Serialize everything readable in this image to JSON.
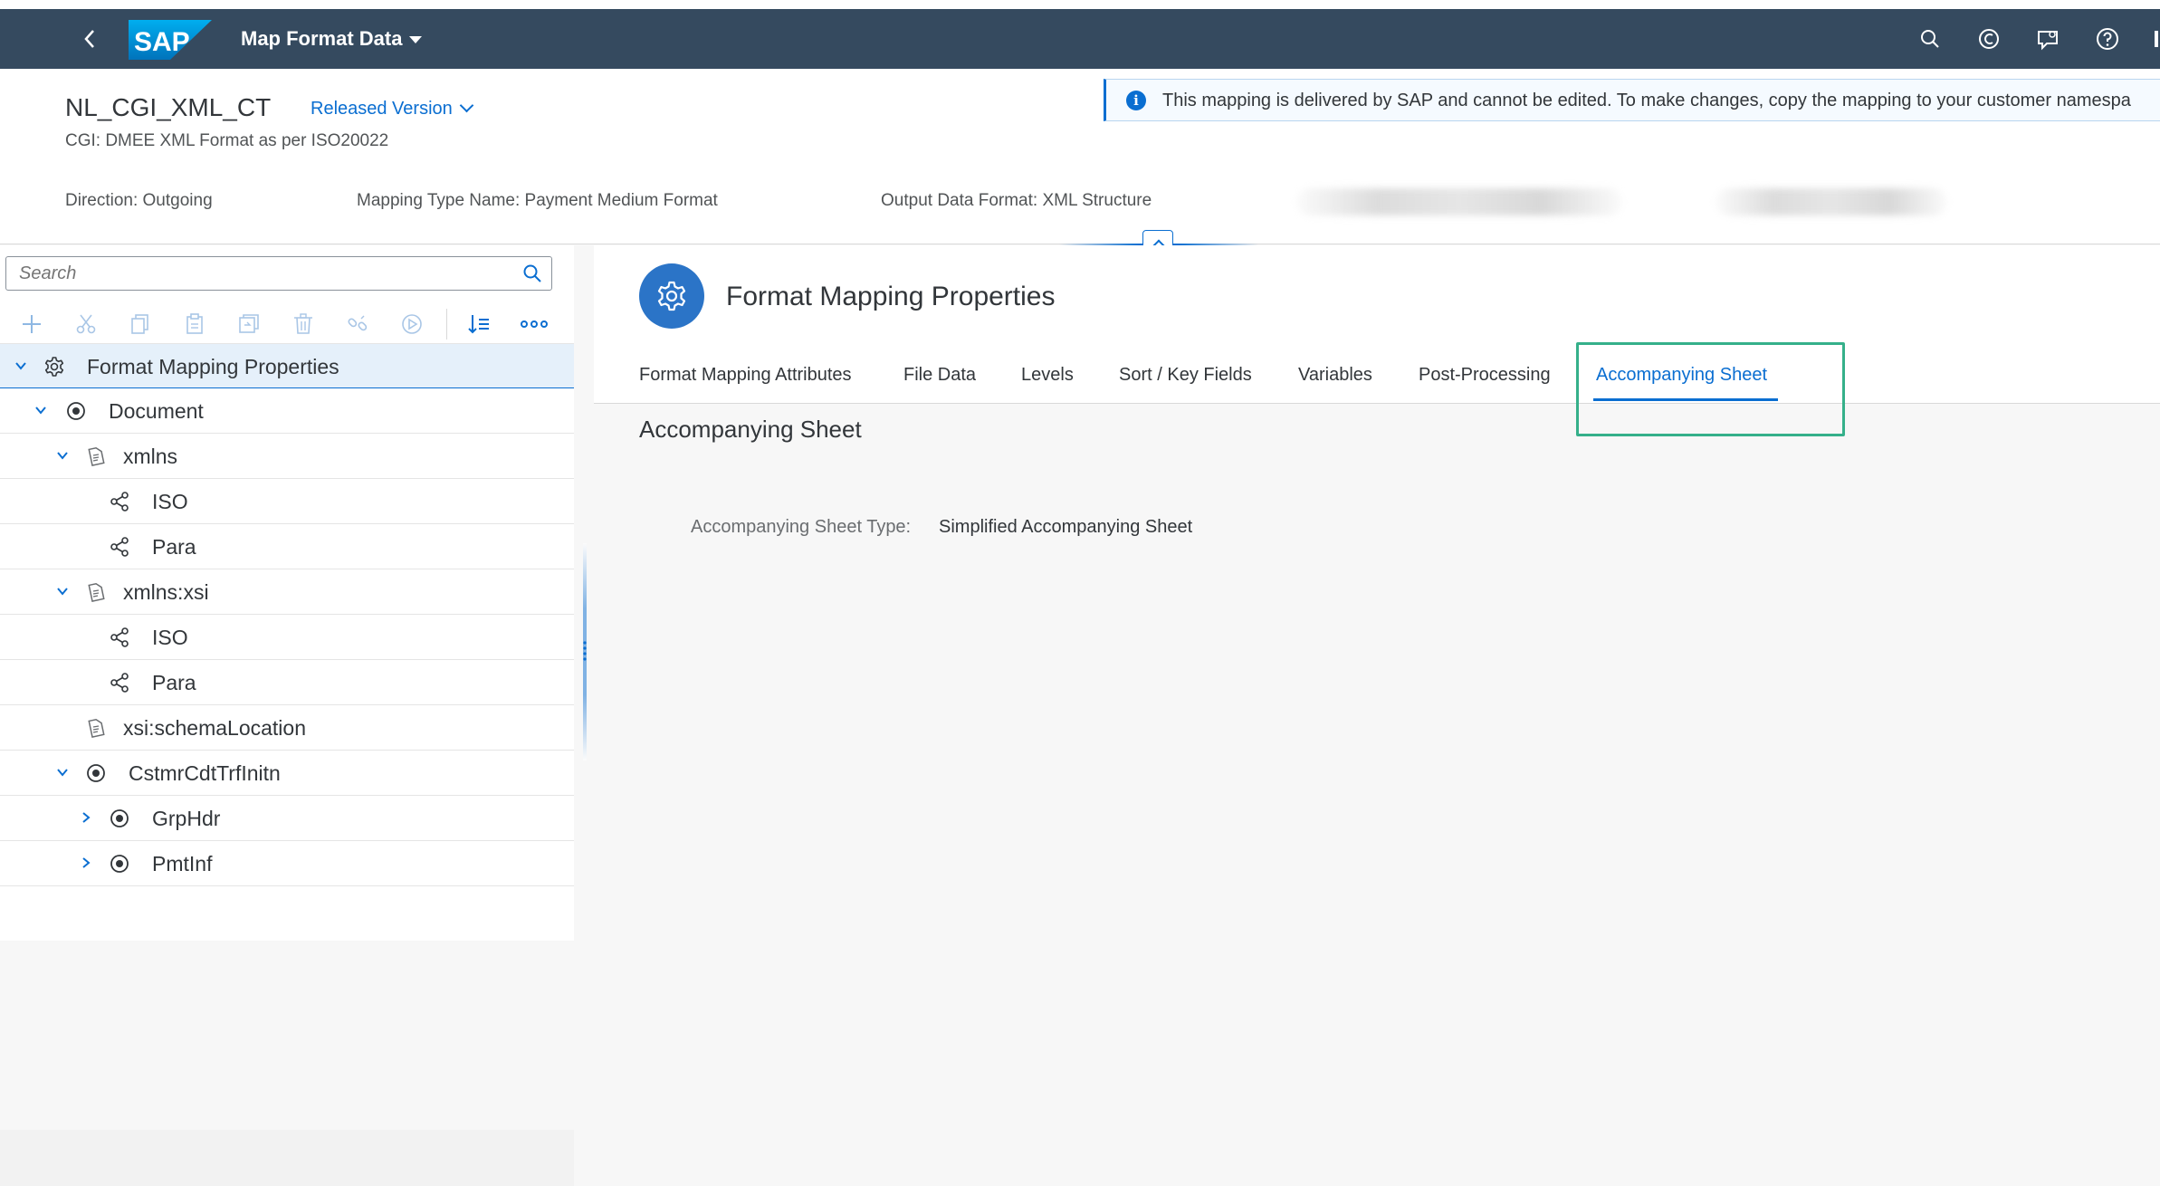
{
  "shell": {
    "app_title": "Map Format Data",
    "logo_text": "SAP"
  },
  "header": {
    "object_title": "NL_CGI_XML_CT",
    "version": "Released Version",
    "subtitle": "CGI: DMEE XML Format as per ISO20022",
    "message": "This mapping is delivered by SAP and cannot be edited. To make changes, copy the mapping to your customer namespa",
    "attributes": [
      "Direction: Outgoing",
      "Mapping Type Name: Payment Medium Format",
      "Output Data Format: XML Structure"
    ]
  },
  "tree": {
    "search_placeholder": "Search",
    "toolbar_icons": [
      "add-icon",
      "cut-icon",
      "copy-icon",
      "paste-icon",
      "duplicate-icon",
      "delete-icon",
      "unlink-icon",
      "run-icon",
      "sort-icon",
      "more-icon"
    ],
    "rows": [
      {
        "label": "Format Mapping Properties",
        "icon": "gear-icon",
        "expander": "down"
      },
      {
        "label": "Document",
        "icon": "radio-node-icon",
        "expander": "down"
      },
      {
        "label": "xmlns",
        "icon": "attribute-icon",
        "expander": "down"
      },
      {
        "label": "ISO",
        "icon": "share-icon",
        "expander": "none"
      },
      {
        "label": "Para",
        "icon": "share-icon",
        "expander": "none"
      },
      {
        "label": "xmlns:xsi",
        "icon": "attribute-icon",
        "expander": "down"
      },
      {
        "label": "ISO",
        "icon": "share-icon",
        "expander": "none"
      },
      {
        "label": "Para",
        "icon": "share-icon",
        "expander": "none"
      },
      {
        "label": "xsi:schemaLocation",
        "icon": "attribute-icon",
        "expander": "none"
      },
      {
        "label": "CstmrCdtTrfInitn",
        "icon": "radio-node-icon",
        "expander": "down"
      },
      {
        "label": "GrpHdr",
        "icon": "radio-node-icon",
        "expander": "right"
      },
      {
        "label": "PmtInf",
        "icon": "radio-node-icon",
        "expander": "right"
      }
    ]
  },
  "detail": {
    "section_title": "Format Mapping Properties",
    "tabs": [
      {
        "label": "Format Mapping Attributes"
      },
      {
        "label": "File Data"
      },
      {
        "label": "Levels"
      },
      {
        "label": "Sort / Key Fields"
      },
      {
        "label": "Variables"
      },
      {
        "label": "Post-Processing"
      },
      {
        "label": "Accompanying Sheet",
        "selected": true
      }
    ],
    "content_title": "Accompanying Sheet",
    "field_label": "Accompanying Sheet Type:",
    "field_value": "Simplified Accompanying Sheet"
  },
  "colors": {
    "shell": "#354a5f",
    "accent": "#0a6ed1",
    "highlight": "#35b08a"
  }
}
